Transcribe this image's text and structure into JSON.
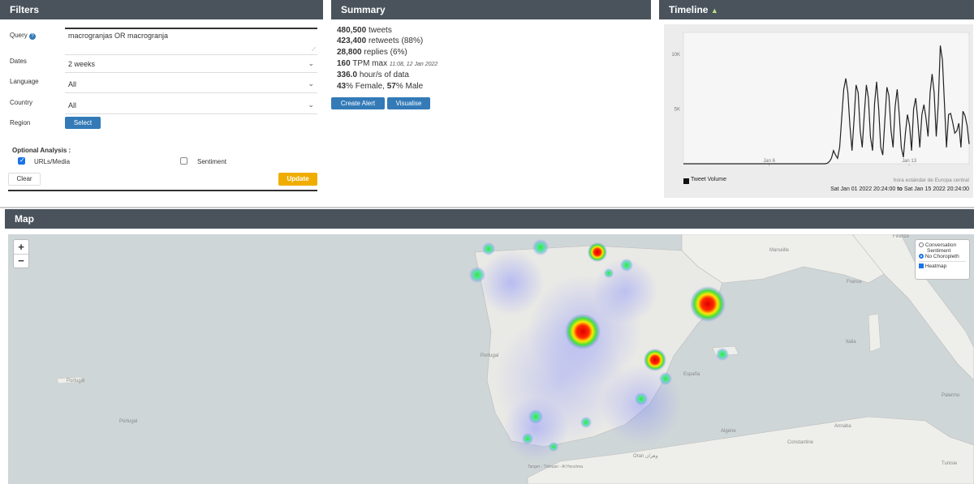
{
  "filters": {
    "title": "Filters",
    "query_label": "Query",
    "query_value": "macrogranjas OR macrogranja",
    "dates_label": "Dates",
    "dates_value": "2 weeks",
    "language_label": "Language",
    "language_value": "All",
    "country_label": "Country",
    "country_value": "All",
    "region_label": "Region",
    "select_button": "Select",
    "optional_label": "Optional Analysis :",
    "urls_label": "URLs/Media",
    "urls_checked": true,
    "sentiment_label": "Sentiment",
    "sentiment_checked": false,
    "clear_button": "Clear",
    "update_button": "Update"
  },
  "summary": {
    "title": "Summary",
    "tweets_num": "480,500",
    "tweets_text": "tweets",
    "retweets_num": "423,400",
    "retweets_text": "retweets (88%)",
    "replies_num": "28,800",
    "replies_text": "replies (6%)",
    "tpm_num": "160",
    "tpm_text": "TPM max",
    "tpm_time": "11:08, 12 Jan 2022",
    "hours_num": "336.0",
    "hours_text": "hour/s of data",
    "female_pct": "43",
    "female_text": "% Female,",
    "male_pct": "57",
    "male_text": "% Male",
    "create_alert_button": "Create Alert",
    "visualise_button": "Visualise"
  },
  "timeline": {
    "title": "Timeline",
    "legend_label": "Tweet Volume",
    "timezone": "hora estándar de Europa central",
    "range_start": "Sat Jan 01 2022 20:24:00",
    "range_to": "to",
    "range_end": "Sat Jan 15 2022 20:24:00",
    "line_color": "#222222"
  },
  "chart_data": {
    "type": "line",
    "ylim": [
      0,
      12000
    ],
    "y_ticks": [
      "10K",
      "5K"
    ],
    "x_ticks": [
      "Jan 6",
      "Jan 13"
    ],
    "series": [
      {
        "values": [
          0,
          0,
          0,
          0,
          0,
          0,
          0,
          0,
          0,
          0,
          0,
          0,
          0,
          0,
          0,
          0,
          0,
          0,
          0,
          0,
          0,
          0,
          0,
          0,
          0,
          0,
          0,
          0,
          0,
          0,
          0,
          0,
          0,
          0,
          0,
          0,
          0,
          0,
          0,
          0,
          0,
          0,
          0,
          0,
          0,
          0,
          0,
          0,
          0,
          0,
          0,
          0,
          0,
          0,
          0,
          0,
          0,
          0,
          0,
          0,
          0,
          0,
          0,
          0,
          0,
          0,
          0,
          0,
          0,
          0,
          50,
          200,
          500,
          1200,
          800,
          500,
          1500,
          4200,
          6800,
          7800,
          6500,
          3500,
          1200,
          4000,
          7200,
          6500,
          3000,
          1500,
          4500,
          7200,
          6000,
          2500,
          1200,
          5500,
          7500,
          5000,
          1500,
          800,
          4000,
          7000,
          6200,
          3000,
          1500,
          5200,
          6800,
          4500,
          1500,
          600,
          2800,
          4500,
          3500,
          1200,
          5000,
          6000,
          4000,
          1500,
          4500,
          5400,
          4200,
          2500,
          6500,
          8200,
          6500,
          2500,
          5500,
          10800,
          9500,
          5500,
          1500,
          4500,
          4600,
          3800,
          2800,
          3000,
          3700,
          1500,
          4800,
          4400,
          3500,
          1800
        ]
      }
    ]
  },
  "map": {
    "title": "Map",
    "zoom_in": "+",
    "zoom_out": "−",
    "radio_conversation": "Conversation",
    "radio_sentiment": "Sentiment",
    "radio_no_choropleth": "No Choropleth",
    "heatmap_label": "Heatmap",
    "labels": {
      "portugal1": "Portugal",
      "portugal2": "Portugal",
      "portugal3": "Portugal",
      "france": "France",
      "espana": "España",
      "italia": "Italia",
      "algerie": "Algérie",
      "tunisie": "Tunisie",
      "marseille": "Marseille",
      "firenze": "Firenze",
      "palermo": "Palermo",
      "constantine": "Constantine",
      "annaba": "Annaba",
      "oran": "Oran وهران",
      "tanger": "Tanger - Tétouan - Al Hoceïma"
    }
  }
}
